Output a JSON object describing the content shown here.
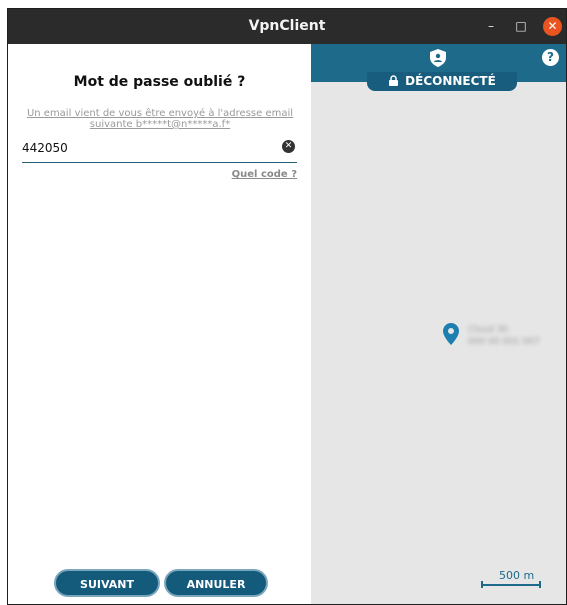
{
  "window": {
    "title": "VpnClient",
    "minimize_glyph": "–",
    "maximize_glyph": "□",
    "close_glyph": "✕"
  },
  "form": {
    "heading": "Mot de passe oublié ?",
    "notice": "Un email vient de vous être envoyé à l'adresse email suivante b*****t@n*****a.f*",
    "code_value": "442050",
    "clear_glyph": "✕",
    "help_link": "Quel code ?",
    "next_label": "SUIVANT",
    "cancel_label": "ANNULER"
  },
  "vpn": {
    "status": "DÉCONNECTÉ",
    "help_glyph": "?",
    "location_label_line1": "Cloud 30",
    "location_label_line2": "000 00 001 007",
    "scale_label": "500 m"
  },
  "colors": {
    "brand": "#1d6a8b",
    "button": "#135a7b",
    "titlebar": "#2b2b2b",
    "close": "#e95420"
  },
  "icons": [
    "shield-icon",
    "lock-icon",
    "help-icon",
    "map-pin-icon",
    "clear-icon",
    "close-icon"
  ]
}
